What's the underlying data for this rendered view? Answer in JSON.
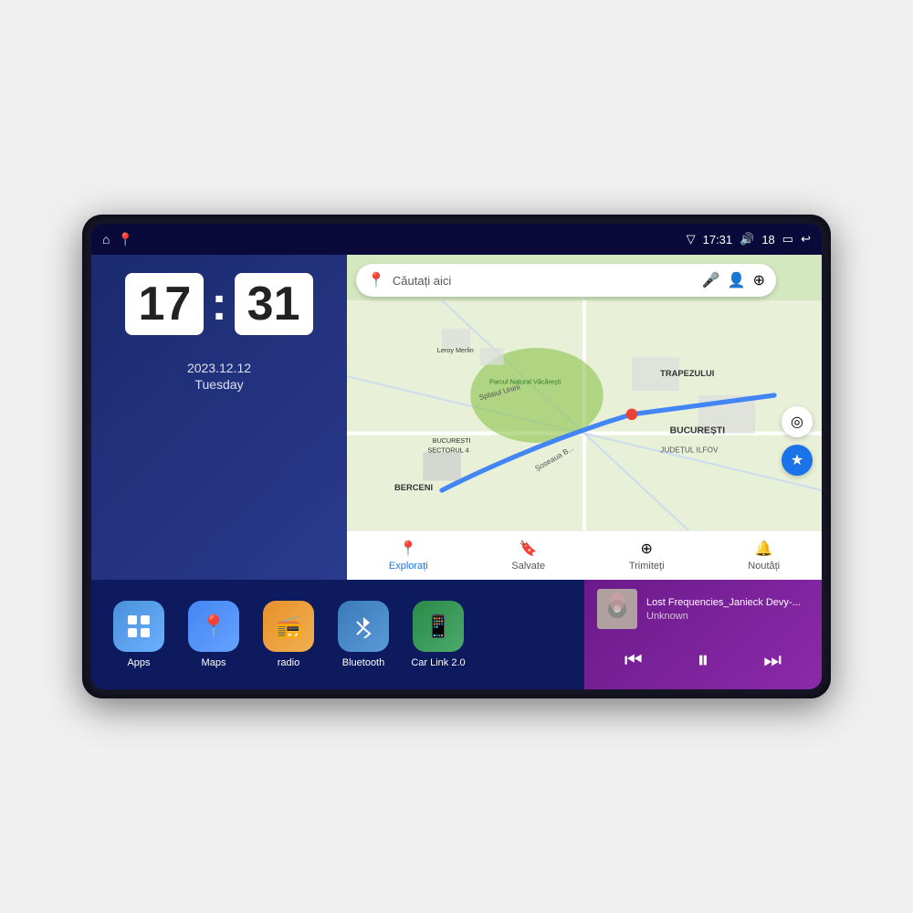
{
  "device": {
    "status_bar": {
      "left_icons": [
        "home",
        "maps"
      ],
      "time": "17:31",
      "signal_icon": "▽",
      "volume_icon": "🔊",
      "volume_level": "18",
      "battery_icon": "🔋",
      "back_icon": "↩"
    },
    "clock": {
      "hours": "17",
      "minutes": "31",
      "date": "2023.12.12",
      "day": "Tuesday"
    },
    "map": {
      "search_placeholder": "Căutați aici",
      "location_labels": [
        "TRAPEZULUI",
        "BUCUREȘTI",
        "JUDEȚUL ILFOV",
        "BERCENI",
        "Parcul Natural Văcărești",
        "Leroy Merlin",
        "BUCUREȘTI SECTORUL 4"
      ],
      "tabs": [
        {
          "icon": "📍",
          "label": "Explorați",
          "active": true
        },
        {
          "icon": "🔖",
          "label": "Salvate",
          "active": false
        },
        {
          "icon": "↗",
          "label": "Trimiteți",
          "active": false
        },
        {
          "icon": "🔔",
          "label": "Noutăți",
          "active": false
        }
      ]
    },
    "apps": [
      {
        "id": "apps",
        "label": "Apps",
        "icon": "⊞",
        "color_class": "app-icon-apps"
      },
      {
        "id": "maps",
        "label": "Maps",
        "icon": "📍",
        "color_class": "app-icon-maps"
      },
      {
        "id": "radio",
        "label": "radio",
        "icon": "📻",
        "color_class": "app-icon-radio"
      },
      {
        "id": "bluetooth",
        "label": "Bluetooth",
        "icon": "₿",
        "color_class": "app-icon-bt"
      },
      {
        "id": "carlink",
        "label": "Car Link 2.0",
        "icon": "📱",
        "color_class": "app-icon-carlink"
      }
    ],
    "music": {
      "title": "Lost Frequencies_Janieck Devy-...",
      "artist": "Unknown",
      "controls": {
        "prev": "⏮",
        "play": "⏸",
        "next": "⏭"
      }
    }
  }
}
